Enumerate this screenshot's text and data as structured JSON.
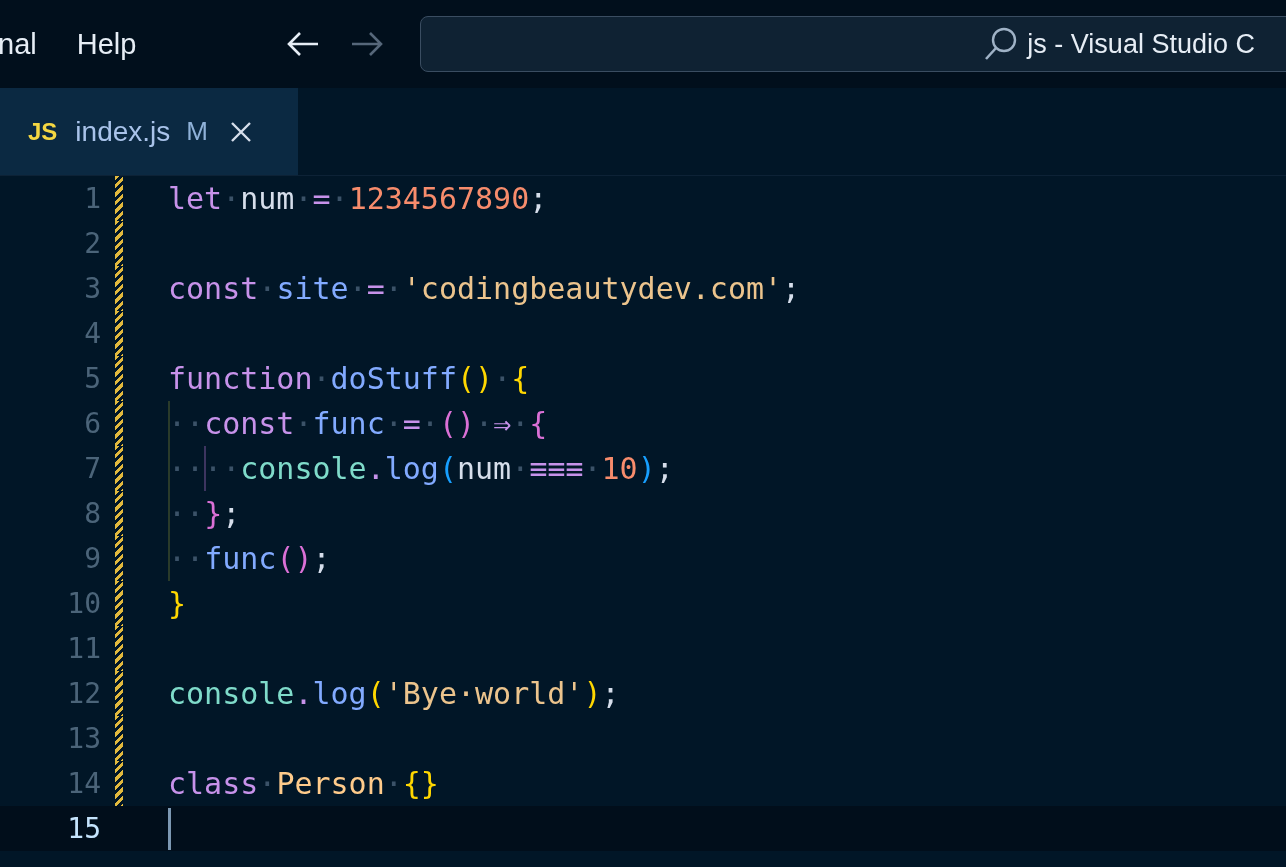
{
  "menu": [
    {
      "label": "nal"
    },
    {
      "label": "Help"
    }
  ],
  "nav": {
    "back_disabled": false,
    "forward_disabled": true
  },
  "search": {
    "value": "js - Visual Studio C"
  },
  "tabs": [
    {
      "badge": "JS",
      "label": "index.js",
      "status": "M",
      "selected": true
    }
  ],
  "lines": [
    {
      "number": "1",
      "modified": true,
      "current": false,
      "tokens": [
        {
          "text": "let",
          "kind": "kw"
        },
        {
          "text": "·",
          "kind": "ws"
        },
        {
          "text": "num",
          "kind": "id"
        },
        {
          "text": "·",
          "kind": "ws"
        },
        {
          "text": "=",
          "kind": "op"
        },
        {
          "text": "·",
          "kind": "ws"
        },
        {
          "text": "1234567890",
          "kind": "num"
        },
        {
          "text": ";",
          "kind": "punct"
        }
      ]
    },
    {
      "number": "2",
      "modified": true,
      "current": false
    },
    {
      "number": "3",
      "modified": true,
      "current": false,
      "tokens": [
        {
          "text": "const",
          "kind": "kw"
        },
        {
          "text": "·",
          "kind": "ws"
        },
        {
          "text": "site",
          "kind": "var"
        },
        {
          "text": "·",
          "kind": "ws"
        },
        {
          "text": "=",
          "kind": "op"
        },
        {
          "text": "·",
          "kind": "ws"
        },
        {
          "text": "'codingbeautydev.com'",
          "kind": "str"
        },
        {
          "text": ";",
          "kind": "punct"
        }
      ]
    },
    {
      "number": "4",
      "modified": true,
      "current": false
    },
    {
      "number": "5",
      "modified": true,
      "current": false,
      "tokens": [
        {
          "text": "function",
          "kind": "kw"
        },
        {
          "text": "·",
          "kind": "ws"
        },
        {
          "text": "doStuff",
          "kind": "fn"
        },
        {
          "text": "()",
          "kind": "p1"
        },
        {
          "text": "·",
          "kind": "ws"
        },
        {
          "text": "{",
          "kind": "p1"
        }
      ]
    },
    {
      "number": "6",
      "modified": true,
      "current": false,
      "tokens": [
        {
          "text": "··",
          "kind": "ws"
        },
        {
          "text": "const",
          "kind": "kw"
        },
        {
          "text": "·",
          "kind": "ws"
        },
        {
          "text": "func",
          "kind": "var"
        },
        {
          "text": "·",
          "kind": "ws"
        },
        {
          "text": "=",
          "kind": "op"
        },
        {
          "text": "·",
          "kind": "ws"
        },
        {
          "text": "()",
          "kind": "p2"
        },
        {
          "text": "·",
          "kind": "ws"
        },
        {
          "text": "⇒",
          "kind": "op"
        },
        {
          "text": "·",
          "kind": "ws"
        },
        {
          "text": "{",
          "kind": "p2"
        }
      ]
    },
    {
      "number": "7",
      "modified": true,
      "current": false,
      "tokens": [
        {
          "text": "····",
          "kind": "ws"
        },
        {
          "text": "console",
          "kind": "obj"
        },
        {
          "text": ".",
          "kind": "op"
        },
        {
          "text": "log",
          "kind": "fn"
        },
        {
          "text": "(",
          "kind": "p3"
        },
        {
          "text": "num",
          "kind": "id"
        },
        {
          "text": "·",
          "kind": "ws"
        },
        {
          "text": "≡≡≡",
          "kind": "op"
        },
        {
          "text": "·",
          "kind": "ws"
        },
        {
          "text": "10",
          "kind": "num"
        },
        {
          "text": ")",
          "kind": "p3"
        },
        {
          "text": ";",
          "kind": "punct"
        }
      ]
    },
    {
      "number": "8",
      "modified": true,
      "current": false,
      "tokens": [
        {
          "text": "··",
          "kind": "ws"
        },
        {
          "text": "}",
          "kind": "p2"
        },
        {
          "text": ";",
          "kind": "punct"
        }
      ]
    },
    {
      "number": "9",
      "modified": true,
      "current": false,
      "tokens": [
        {
          "text": "··",
          "kind": "ws"
        },
        {
          "text": "func",
          "kind": "fn"
        },
        {
          "text": "()",
          "kind": "p2"
        },
        {
          "text": ";",
          "kind": "punct"
        }
      ]
    },
    {
      "number": "10",
      "modified": true,
      "current": false,
      "tokens": [
        {
          "text": "}",
          "kind": "p1"
        }
      ]
    },
    {
      "number": "11",
      "modified": true,
      "current": false
    },
    {
      "number": "12",
      "modified": true,
      "current": false,
      "tokens": [
        {
          "text": "console",
          "kind": "obj"
        },
        {
          "text": ".",
          "kind": "op"
        },
        {
          "text": "log",
          "kind": "fn"
        },
        {
          "text": "(",
          "kind": "p1"
        },
        {
          "text": "'Bye·world'",
          "kind": "str"
        },
        {
          "text": ")",
          "kind": "p1"
        },
        {
          "text": ";",
          "kind": "punct"
        }
      ]
    },
    {
      "number": "13",
      "modified": true,
      "current": false
    },
    {
      "number": "14",
      "modified": true,
      "current": false,
      "tokens": [
        {
          "text": "class",
          "kind": "kw"
        },
        {
          "text": "·",
          "kind": "ws"
        },
        {
          "text": "Person",
          "kind": "cls"
        },
        {
          "text": "·",
          "kind": "ws"
        },
        {
          "text": "{}",
          "kind": "p1"
        }
      ]
    },
    {
      "number": "15",
      "modified": false,
      "current": true
    }
  ]
}
